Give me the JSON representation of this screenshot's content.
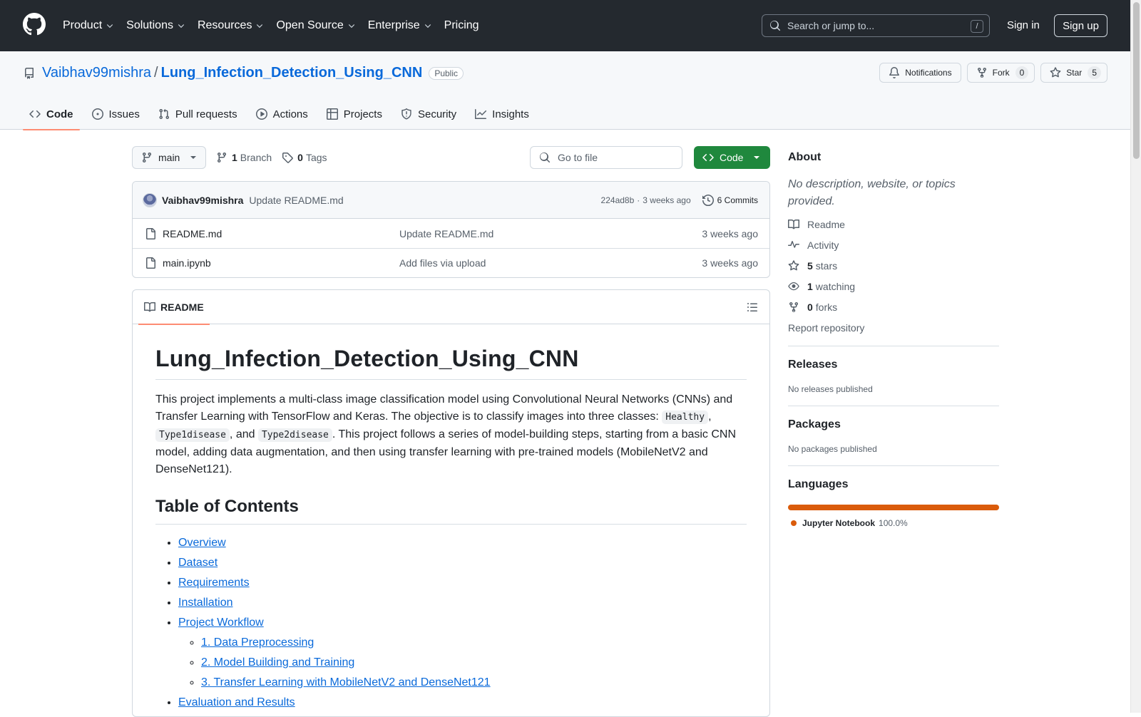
{
  "header": {
    "nav": [
      {
        "label": "Product",
        "dropdown": true
      },
      {
        "label": "Solutions",
        "dropdown": true
      },
      {
        "label": "Resources",
        "dropdown": true
      },
      {
        "label": "Open Source",
        "dropdown": true
      },
      {
        "label": "Enterprise",
        "dropdown": true
      },
      {
        "label": "Pricing",
        "dropdown": false
      }
    ],
    "search_placeholder": "Search or jump to...",
    "search_key": "/",
    "sign_in": "Sign in",
    "sign_up": "Sign up"
  },
  "repo": {
    "owner": "Vaibhav99mishra",
    "separator": "/",
    "name": "Lung_Infection_Detection_Using_CNN",
    "visibility": "Public",
    "actions": {
      "notifications": "Notifications",
      "fork_label": "Fork",
      "fork_count": "0",
      "star_label": "Star",
      "star_count": "5"
    },
    "tabs": [
      {
        "label": "Code",
        "icon": "code-icon",
        "active": true
      },
      {
        "label": "Issues",
        "icon": "issue-icon",
        "active": false
      },
      {
        "label": "Pull requests",
        "icon": "pull-request-icon",
        "active": false
      },
      {
        "label": "Actions",
        "icon": "play-icon",
        "active": false
      },
      {
        "label": "Projects",
        "icon": "table-icon",
        "active": false
      },
      {
        "label": "Security",
        "icon": "shield-icon",
        "active": false
      },
      {
        "label": "Insights",
        "icon": "graph-icon",
        "active": false
      }
    ]
  },
  "toolbar": {
    "branch": "main",
    "branch_count": "1",
    "branch_label": "Branch",
    "tag_count": "0",
    "tag_label": "Tags",
    "goto_placeholder": "Go to file",
    "code_button": "Code"
  },
  "latest_commit": {
    "author": "Vaibhav99mishra",
    "message": "Update README.md",
    "hash": "224ad8b",
    "separator": "·",
    "time": "3 weeks ago",
    "commits": "6 Commits"
  },
  "files": [
    {
      "name": "README.md",
      "message": "Update README.md",
      "time": "3 weeks ago"
    },
    {
      "name": "main.ipynb",
      "message": "Add files via upload",
      "time": "3 weeks ago"
    }
  ],
  "readme": {
    "tab_label": "README",
    "title": "Lung_Infection_Detection_Using_CNN",
    "intro": {
      "part1": "This project implements a multi-class image classification model using Convolutional Neural Networks (CNNs) and Transfer Learning with TensorFlow and Keras. The objective is to classify images into three classes: ",
      "code1": "Healthy",
      "part2": ", ",
      "code2": "Type1disease",
      "part3": ", and ",
      "code3": "Type2disease",
      "part4": ". This project follows a series of model-building steps, starting from a basic CNN model, adding data augmentation, and then using transfer learning with pre-trained models (MobileNetV2 and DenseNet121)."
    },
    "toc_title": "Table of Contents",
    "toc": [
      {
        "label": "Overview"
      },
      {
        "label": "Dataset"
      },
      {
        "label": "Requirements"
      },
      {
        "label": "Installation"
      },
      {
        "label": "Project Workflow",
        "children": [
          "1. Data Preprocessing",
          "2. Model Building and Training",
          "3. Transfer Learning with MobileNetV2 and DenseNet121"
        ]
      },
      {
        "label": "Evaluation and Results"
      }
    ]
  },
  "sidebar": {
    "about_title": "About",
    "description": "No description, website, or topics provided.",
    "items": [
      {
        "icon": "book-icon",
        "count": "",
        "label": "Readme"
      },
      {
        "icon": "pulse-icon",
        "count": "",
        "label": "Activity"
      },
      {
        "icon": "star-icon",
        "count": "5",
        "label": "stars"
      },
      {
        "icon": "eye-icon",
        "count": "1",
        "label": "watching"
      },
      {
        "icon": "fork-icon",
        "count": "0",
        "label": "forks"
      }
    ],
    "report": "Report repository",
    "releases_title": "Releases",
    "releases_text": "No releases published",
    "packages_title": "Packages",
    "packages_text": "No packages published",
    "languages_title": "Languages",
    "languages": [
      {
        "name": "Jupyter Notebook",
        "percent": "100.0%",
        "fraction": 1.0,
        "color": "#da5b0b"
      }
    ]
  }
}
